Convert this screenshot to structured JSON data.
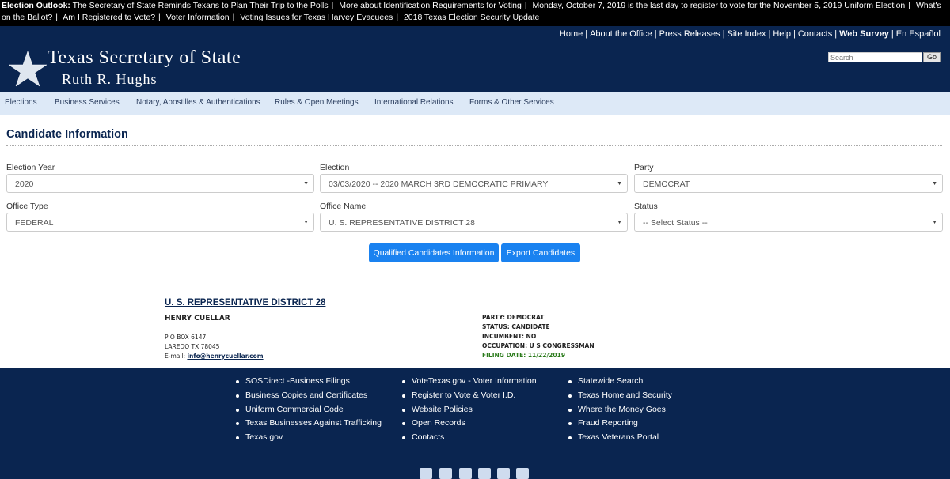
{
  "alert": {
    "lead": "Election Outlook:",
    "items": [
      "The Secretary of State Reminds Texans to Plan Their Trip to the Polls",
      "More about Identification Requirements for Voting",
      "Monday, October 7, 2019 is the last day to register to vote for the November 5, 2019 Uniform Election",
      "What's on the Ballot?",
      "Am I Registered to Vote?",
      "Voter Information",
      "Voting Issues for Texas Harvey Evacuees",
      "2018 Texas Election Security Update"
    ]
  },
  "header": {
    "links": [
      "Home",
      "About the Office",
      "Press Releases",
      "Site Index",
      "Help",
      "Contacts",
      "Web Survey",
      "En Español"
    ],
    "logo_title": "Texas Secretary of State",
    "logo_subtitle": "Ruth R. Hughs",
    "search_placeholder": "Search",
    "go_label": "Go"
  },
  "nav": [
    "Elections",
    "Business Services",
    "Notary, Apostilles & Authentications",
    "Rules & Open Meetings",
    "International Relations",
    "Forms & Other Services"
  ],
  "main": {
    "title": "Candidate Information",
    "filters": {
      "election_year": {
        "label": "Election Year",
        "value": "2020"
      },
      "election": {
        "label": "Election",
        "value": "03/03/2020 -- 2020 MARCH 3RD DEMOCRATIC PRIMARY"
      },
      "party": {
        "label": "Party",
        "value": "DEMOCRAT"
      },
      "office_type": {
        "label": "Office Type",
        "value": "FEDERAL"
      },
      "office_name": {
        "label": "Office Name",
        "value": "U. S. REPRESENTATIVE DISTRICT 28"
      },
      "status": {
        "label": "Status",
        "value": "-- Select Status --"
      }
    },
    "buttons": {
      "qualified": "Qualified Candidates Information",
      "export": "Export Candidates"
    }
  },
  "candidate": {
    "district": "U. S. REPRESENTATIVE DISTRICT 28",
    "name": "HENRY CUELLAR",
    "address1": "P O BOX 6147",
    "address2": "LAREDO TX 78045",
    "email_label": "E-mail:",
    "email": "info@henrycuellar.com",
    "party": "PARTY: DEMOCRAT",
    "status": "STATUS: CANDIDATE",
    "incumbent": "INCUMBENT: NO",
    "occupation": "OCCUPATION: U S CONGRESSMAN",
    "filing_date": "FILING DATE: 11/22/2019"
  },
  "footer": {
    "col1": [
      "SOSDirect -Business Filings",
      "Business Copies and Certificates",
      "Uniform Commercial Code",
      "Texas Businesses Against Trafficking",
      "Texas.gov"
    ],
    "col2": [
      "VoteTexas.gov - Voter Information",
      "Register to Vote & Voter I.D.",
      "Website Policies",
      "Open Records",
      "Contacts"
    ],
    "col3": [
      "Statewide Search",
      "Texas Homeland Security",
      "Where the Money Goes",
      "Fraud Reporting",
      "Texas Veterans Portal"
    ],
    "social_icons": [
      "facebook-icon",
      "instagram-icon",
      "twitter-icon",
      "youtube-icon",
      "rss-icon",
      "email-icon"
    ]
  },
  "colors": {
    "navy": "#0a2550",
    "nav_bg": "#dde9f7",
    "button": "#1a82f0",
    "filing_green": "#2a7a1a"
  }
}
